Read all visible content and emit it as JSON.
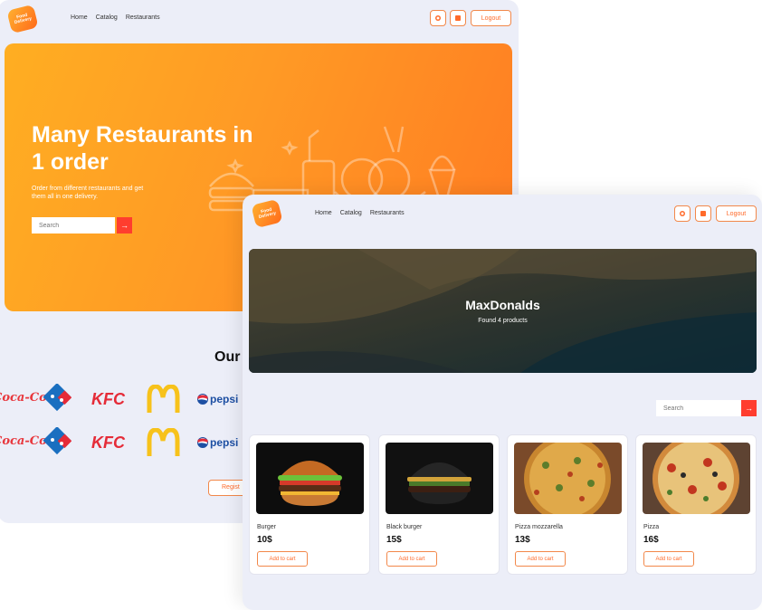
{
  "back_window": {
    "logo_text": "Food Delivery",
    "nav": [
      "Home",
      "Catalog",
      "Restaurants"
    ],
    "logout_label": "Logout",
    "hero": {
      "title": "Many Restaurants in 1 order",
      "subtitle": "Order from different restaurants and get them all in one delivery.",
      "search_placeholder": "Search",
      "search_arrow": "→"
    },
    "partners_heading": "Our",
    "brands_row": [
      "Coca-Cola",
      "Domino's Pizza",
      "KFC",
      "McDonald's",
      "pepsi"
    ],
    "brand_texts": {
      "coca": "Coca-Cola",
      "kfc": "KFC",
      "pepsi": "pepsi"
    },
    "register_label": "Regist"
  },
  "front_window": {
    "logo_text": "Food Delivery",
    "nav": [
      "Home",
      "Catalog",
      "Restaurants"
    ],
    "logout_label": "Logout",
    "banner": {
      "restaurant_name": "MaxDonalds",
      "found_text": "Found 4 products"
    },
    "search_placeholder": "Search",
    "search_arrow": "→",
    "products": [
      {
        "name": "Burger",
        "price": "10$",
        "button": "Add to cart"
      },
      {
        "name": "Black burger",
        "price": "15$",
        "button": "Add to cart"
      },
      {
        "name": "Pizza mozzarella",
        "price": "13$",
        "button": "Add to cart"
      },
      {
        "name": "Pizza",
        "price": "16$",
        "button": "Add to cart"
      }
    ]
  },
  "colors": {
    "accent": "#ff6a2a",
    "search_button": "#ff3d2e",
    "hero_start": "#ffae22",
    "hero_end": "#ff7b22",
    "page_bg": "#eceef8"
  }
}
